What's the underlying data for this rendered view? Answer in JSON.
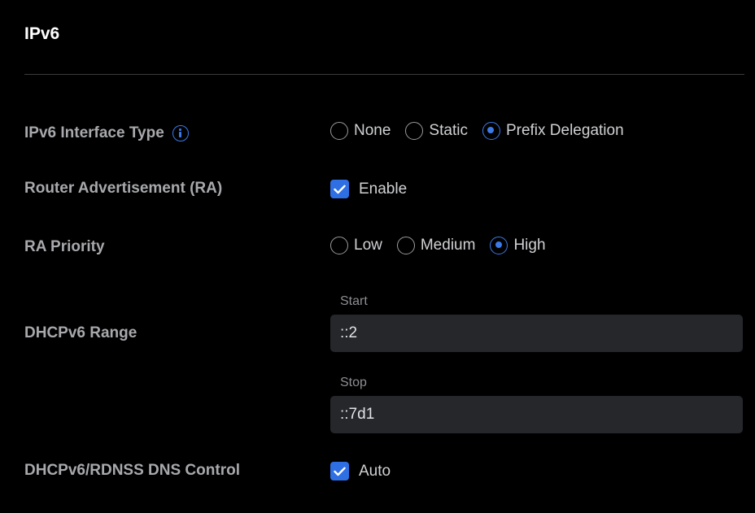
{
  "section": {
    "title": "IPv6"
  },
  "interface_type": {
    "label": "IPv6 Interface Type",
    "options": [
      "None",
      "Static",
      "Prefix Delegation"
    ],
    "selected": "Prefix Delegation"
  },
  "router_advertisement": {
    "label": "Router Advertisement (RA)",
    "checkbox_label": "Enable",
    "checked": true
  },
  "ra_priority": {
    "label": "RA Priority",
    "options": [
      "Low",
      "Medium",
      "High"
    ],
    "selected": "High"
  },
  "dhcpv6_range": {
    "label": "DHCPv6 Range",
    "start_label": "Start",
    "start_value": "::2",
    "stop_label": "Stop",
    "stop_value": "::7d1"
  },
  "dns_control": {
    "label": "DHCPv6/RDNSS DNS Control",
    "checkbox_label": "Auto",
    "checked": true
  },
  "colors": {
    "accent": "#3d7ae6",
    "checkbox": "#2f6fe4",
    "background": "#000000",
    "field": "#26272b"
  }
}
